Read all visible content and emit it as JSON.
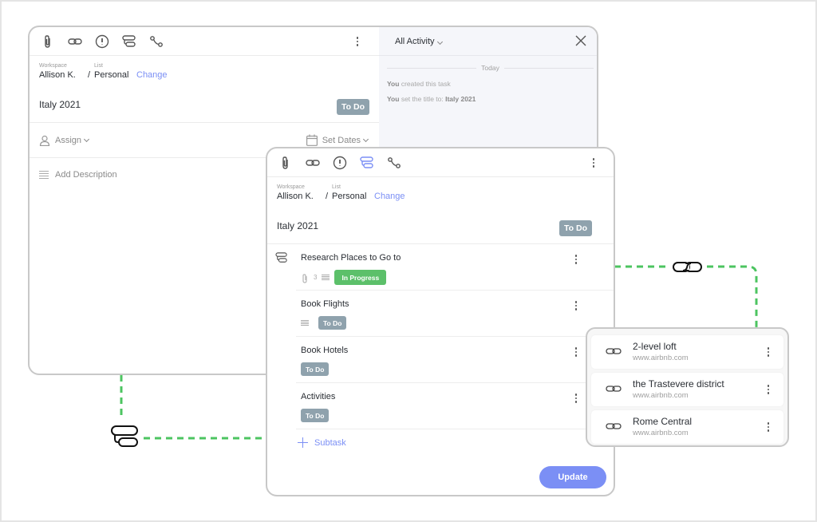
{
  "colors": {
    "accent": "#7b8ff5",
    "todo": "#8fa2ad",
    "in_progress": "#5cc06a",
    "connector": "#4cc460"
  },
  "card_back": {
    "toolbar_icons": [
      "paperclip-icon",
      "link-icon",
      "priority-icon",
      "subtask-icon",
      "dependency-icon"
    ],
    "workspace_label": "Workspace",
    "workspace_value": "Allison K.",
    "list_label": "List",
    "list_separator": "/",
    "list_value": "Personal",
    "change_label": "Change",
    "title": "Italy 2021",
    "status": "To Do",
    "assign_label": "Assign",
    "set_dates_label": "Set Dates",
    "description_placeholder": "Add Description",
    "activity": {
      "filter_label": "All Activity",
      "divider_label": "Today",
      "items": [
        {
          "actor": "You",
          "text": "created this task",
          "target": ""
        },
        {
          "actor": "You",
          "text": "set the title to:",
          "target": "Italy 2021"
        }
      ]
    }
  },
  "card_front": {
    "toolbar_icons": [
      "paperclip-icon",
      "link-icon",
      "priority-icon",
      "subtask-icon",
      "dependency-icon"
    ],
    "active_icon": "subtask-icon",
    "workspace_label": "Workspace",
    "workspace_value": "Allison K.",
    "list_label": "List",
    "list_separator": "/",
    "list_value": "Personal",
    "change_label": "Change",
    "title": "Italy 2021",
    "status": "To Do",
    "subtasks": [
      {
        "name": "Research Places to Go to",
        "attachments": "3",
        "has_description": true,
        "status": "In Progress"
      },
      {
        "name": "Book Flights",
        "attachments": "",
        "has_description": true,
        "status": "To Do"
      },
      {
        "name": "Book Hotels",
        "attachments": "",
        "has_description": false,
        "status": "To Do"
      },
      {
        "name": "Activities",
        "attachments": "",
        "has_description": false,
        "status": "To Do"
      }
    ],
    "add_subtask_label": "Subtask",
    "update_label": "Update"
  },
  "links": [
    {
      "title": "2-level loft",
      "url": "www.airbnb.com"
    },
    {
      "title": "the Trastevere district",
      "url": "www.airbnb.com"
    },
    {
      "title": "Rome Central",
      "url": "www.airbnb.com"
    }
  ]
}
